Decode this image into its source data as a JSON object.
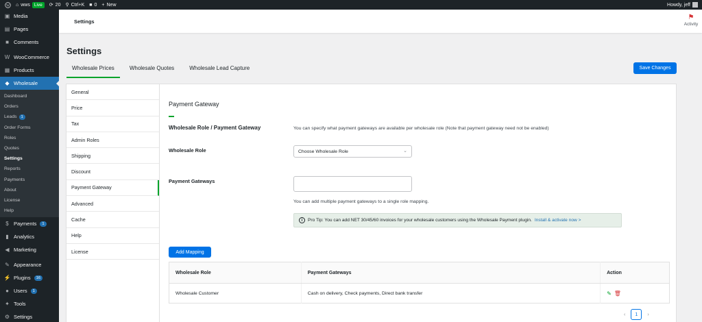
{
  "adminbar": {
    "site_name": "wws",
    "live_badge": "Live",
    "updates_count": "20",
    "shortcut": "Ctrl+K",
    "comments_count": "0",
    "new_label": "New",
    "howdy": "Howdy, jeff"
  },
  "sidebar": {
    "items_top": [
      {
        "label": "Media",
        "icon": "media-icon"
      },
      {
        "label": "Pages",
        "icon": "pages-icon"
      },
      {
        "label": "Comments",
        "icon": "comments-icon"
      },
      {
        "label": "WooCommerce",
        "icon": "woocommerce-icon"
      },
      {
        "label": "Products",
        "icon": "products-icon"
      },
      {
        "label": "Wholesale",
        "icon": "wholesale-icon"
      }
    ],
    "submenu": [
      "Dashboard",
      "Orders",
      "Leads",
      "Order Forms",
      "Roles",
      "Quotes",
      "Settings",
      "Reports",
      "Payments",
      "About",
      "License",
      "Help"
    ],
    "leads_count": "1",
    "items_bottom": [
      {
        "label": "Payments",
        "count": "1"
      },
      {
        "label": "Analytics"
      },
      {
        "label": "Marketing"
      },
      {
        "label": "Appearance"
      },
      {
        "label": "Plugins",
        "count": "16"
      },
      {
        "label": "Users",
        "count": "1"
      },
      {
        "label": "Tools"
      },
      {
        "label": "Settings"
      }
    ]
  },
  "header": {
    "breadcrumb": "Settings",
    "activity_label": "Activity"
  },
  "main": {
    "title": "Settings",
    "tabs": [
      "Wholesale Prices",
      "Wholesale Quotes",
      "Wholesale Lead Capture"
    ],
    "save_label": "Save Changes"
  },
  "settings_nav": [
    "General",
    "Price",
    "Tax",
    "Admin Roles",
    "Shipping",
    "Discount",
    "Payment Gateway",
    "Advanced",
    "Cache",
    "Help",
    "License"
  ],
  "content": {
    "section_title": "Payment Gateway",
    "mapping_label": "Wholesale Role / Payment Gateway",
    "mapping_desc": "You can specify what payment gateways are available per wholesale role (Note that payment gateway need not be enabled)",
    "role_label": "Wholesale Role",
    "role_placeholder": "Choose Wholesale Role",
    "gateways_label": "Payment Gateways",
    "gateways_help": "You can add multiple payment gateways to a single role mapping.",
    "tip_text": "Pro Tip: You can add NET 30/45/60 invoices for your wholesale customers using the Wholesale Payment plugin.",
    "tip_link": "Install & activate now >",
    "add_button": "Add Mapping"
  },
  "table": {
    "headers": [
      "Wholesale Role",
      "Payment Gateways",
      "Action"
    ],
    "rows": [
      {
        "role": "Wholesale Customer",
        "gateways": "Cash on delivery, Check payments, Direct bank transfer"
      }
    ]
  },
  "pagination": {
    "current_page": "1"
  }
}
